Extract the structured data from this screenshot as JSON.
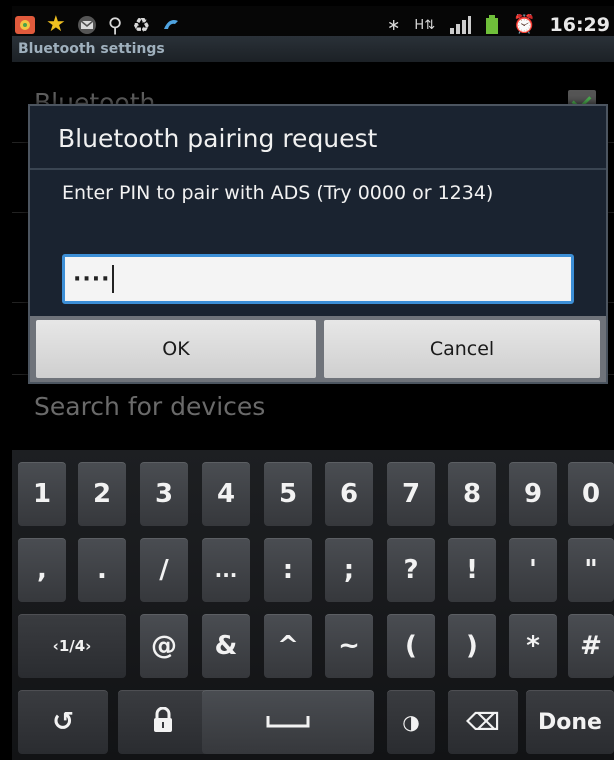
{
  "status_bar": {
    "time": "16:29",
    "left_icons": [
      "photo-icon",
      "star-icon",
      "mail-icon",
      "usb-icon",
      "recycle-icon",
      "phone-icon"
    ],
    "right_icons": [
      "bluetooth-icon",
      "data-icon",
      "signal-icon",
      "battery-icon",
      "alarm-icon"
    ]
  },
  "title_bar": {
    "title": "Bluetooth settings"
  },
  "background": {
    "bluetooth_label": "Bluetooth",
    "search_label": "Search for devices"
  },
  "dialog": {
    "title": "Bluetooth pairing request",
    "message": "Enter PIN to pair with ADS (Try 0000 or 1234)",
    "pin_value": "····",
    "ok_label": "OK",
    "cancel_label": "Cancel"
  },
  "keyboard": {
    "row1": [
      "1",
      "2",
      "3",
      "4",
      "5",
      "6",
      "7",
      "8",
      "9",
      "0"
    ],
    "row2": [
      ",",
      ".",
      "/",
      "...",
      ":",
      ";",
      "?",
      "!",
      "'",
      "\""
    ],
    "row3": [
      "‹1/4›",
      "@",
      "&",
      "^",
      "~",
      "(",
      ")",
      "*",
      "#"
    ],
    "row4": {
      "undo": "↺",
      "lock": "🔒",
      "space": "␣",
      "mode": "◑",
      "backspace": "⌫",
      "done": "Done"
    }
  },
  "colors": {
    "accent": "#3d8fd6",
    "dialog_bg": "#1a2330",
    "key_bg": "#44474b"
  }
}
